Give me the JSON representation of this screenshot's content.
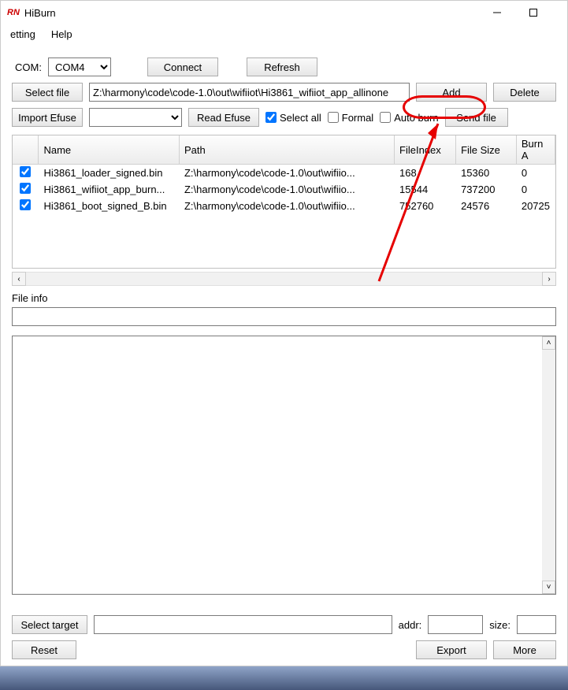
{
  "window": {
    "title": "HiBurn"
  },
  "menu": {
    "setting": "etting",
    "help": "Help"
  },
  "com": {
    "label": "COM:",
    "value": "COM4",
    "connect": "Connect",
    "refresh": "Refresh"
  },
  "file": {
    "select": "Select file",
    "path": "Z:\\harmony\\code\\code-1.0\\out\\wifiiot\\Hi3861_wifiiot_app_allinone",
    "add": "Add",
    "delete": "Delete"
  },
  "efuse": {
    "import": "Import Efuse",
    "value": "",
    "read": "Read Efuse",
    "selectall": "Select all",
    "formal": "Formal",
    "autoburn": "Auto burn",
    "sendfile": "Send file"
  },
  "table": {
    "headers": {
      "name": "Name",
      "path": "Path",
      "fileindex": "FileIndex",
      "filesize": "File Size",
      "burn": "Burn A"
    },
    "rows": [
      {
        "checked": true,
        "name": "Hi3861_loader_signed.bin",
        "path": "Z:\\harmony\\code\\code-1.0\\out\\wifiio...",
        "index": "168",
        "size": "15360",
        "burn": "0"
      },
      {
        "checked": true,
        "name": "Hi3861_wifiiot_app_burn...",
        "path": "Z:\\harmony\\code\\code-1.0\\out\\wifiio...",
        "index": "15544",
        "size": "737200",
        "burn": "0"
      },
      {
        "checked": true,
        "name": "Hi3861_boot_signed_B.bin",
        "path": "Z:\\harmony\\code\\code-1.0\\out\\wifiio...",
        "index": "752760",
        "size": "24576",
        "burn": "20725"
      }
    ]
  },
  "fileinfo": {
    "label": "File info"
  },
  "target": {
    "select": "Select target",
    "value": "",
    "addr_label": "addr:",
    "addr_value": "",
    "size_label": "size:",
    "size_value": ""
  },
  "footer": {
    "reset": "Reset",
    "export": "Export",
    "more": "More"
  }
}
